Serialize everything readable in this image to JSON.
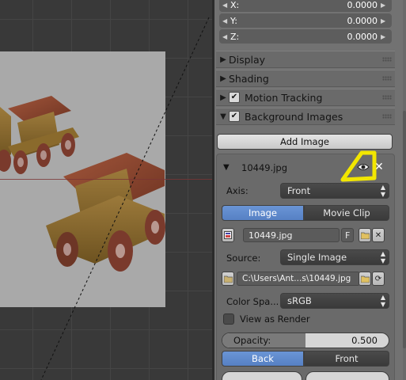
{
  "transform": {
    "x": {
      "label": "X:",
      "value": "0.0000"
    },
    "y": {
      "label": "Y:",
      "value": "0.0000"
    },
    "z": {
      "label": "Z:",
      "value": "0.0000"
    }
  },
  "panels": [
    {
      "label": "Display",
      "collapsed": true,
      "checkbox": false
    },
    {
      "label": "Shading",
      "collapsed": true,
      "checkbox": false
    },
    {
      "label": "Motion Tracking",
      "collapsed": true,
      "checkbox": true
    },
    {
      "label": "Background Images",
      "collapsed": false,
      "checkbox": true
    }
  ],
  "background_images": {
    "add_button": "Add Image",
    "item_name": "10449.jpg",
    "axis_label": "Axis:",
    "axis_value": "Front",
    "source_tabs": [
      "Image",
      "Movie Clip"
    ],
    "active_source_tab": "Image",
    "image_name": "10449.jpg",
    "fake_user": "F",
    "source_label": "Source:",
    "source_value": "Single Image",
    "filepath": "C:\\Users\\Ant...s\\10449.jpg",
    "color_space_label": "Color Spa...",
    "color_space_value": "sRGB",
    "view_as_render_label": "View as Render",
    "view_as_render": false,
    "opacity_label": "Opacity:",
    "opacity_value": "0.500",
    "opacity_fraction": 0.5,
    "depth_tabs": [
      "Back",
      "Front"
    ],
    "active_depth_tab": "Back"
  },
  "colors": {
    "annotation": "#f2e600",
    "active_blue": "#5a86c9",
    "panel_bg": "#727272"
  },
  "icons": {
    "visibility": "eye-icon",
    "remove": "close-icon",
    "image_browse": "image-icon",
    "file_browse": "folder-icon",
    "reload": "refresh-icon"
  }
}
